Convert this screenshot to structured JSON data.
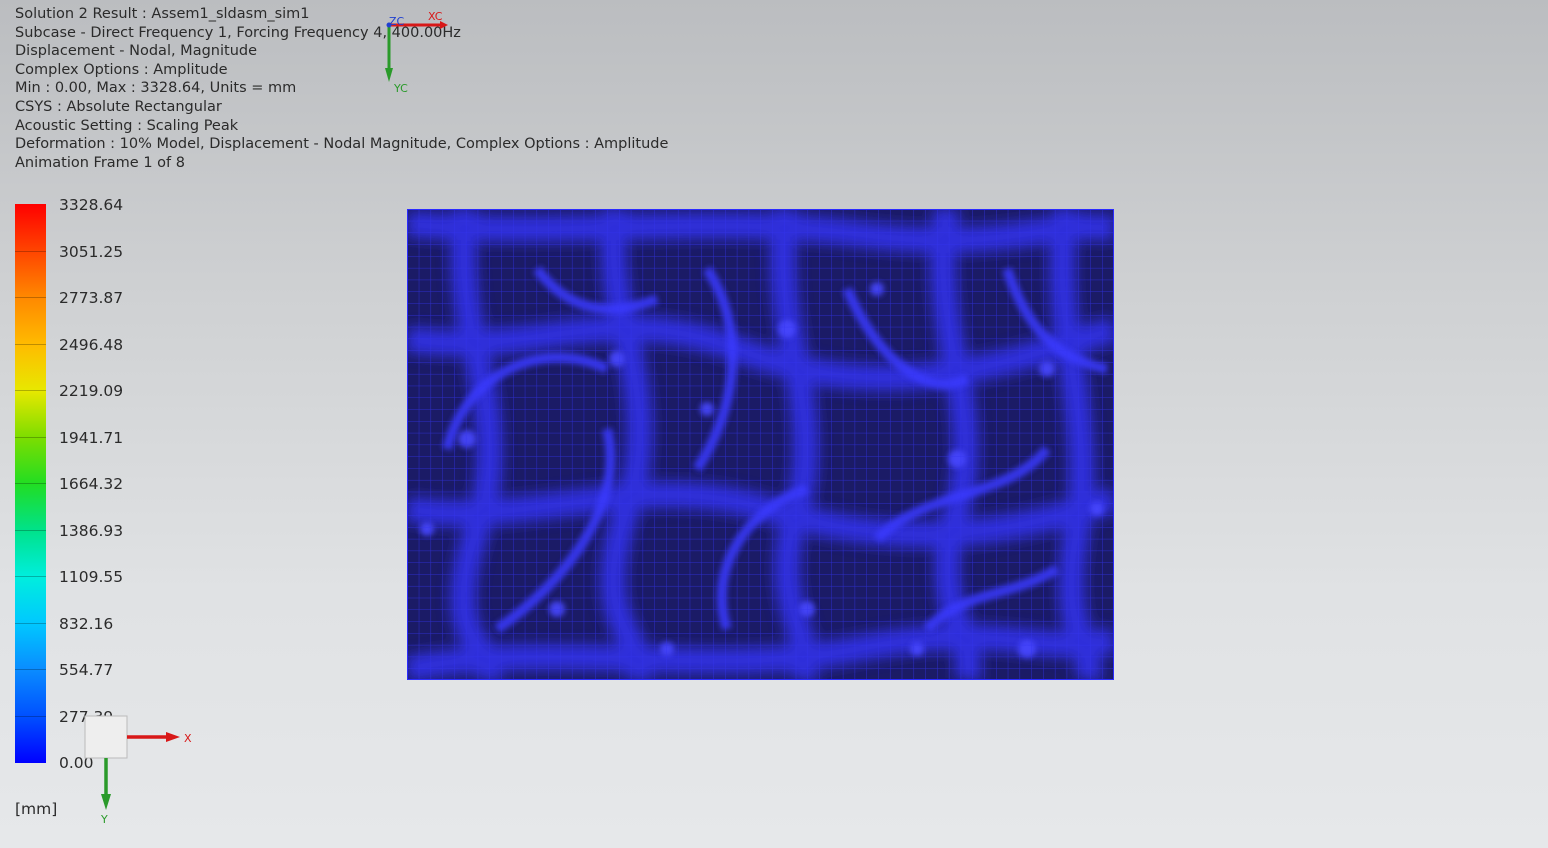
{
  "info": {
    "lines": [
      "Solution 2 Result : Assem1_sldasm_sim1",
      "Subcase - Direct Frequency 1, Forcing Frequency 4, 400.00Hz",
      "Displacement - Nodal, Magnitude",
      "Complex Options : Amplitude",
      "Min : 0.00, Max : 3328.64, Units = mm",
      "CSYS : Absolute Rectangular",
      "Acoustic Setting : Scaling Peak",
      "Deformation : 10% Model, Displacement - Nodal Magnitude, Complex Options : Amplitude",
      "Animation Frame 1 of 8"
    ]
  },
  "legend": {
    "values": [
      "3328.64",
      "3051.25",
      "2773.87",
      "2496.48",
      "2219.09",
      "1941.71",
      "1664.32",
      "1386.93",
      "1109.55",
      "832.16",
      "554.77",
      "277.39",
      "0.00"
    ],
    "units": "[mm]",
    "colors": [
      "#ff0000",
      "#ff4400",
      "#ff8800",
      "#ffba00",
      "#e8e800",
      "#7edd00",
      "#22dd22",
      "#00e28a",
      "#00eedd",
      "#00c8ff",
      "#0a8cff",
      "#0050ff",
      "#0000ff"
    ]
  },
  "view_triad": {
    "xc": "XC",
    "yc": "YC",
    "zc": "ZC",
    "x_color": "#d81818",
    "y_color": "#2a9a2a",
    "z_color": "#2040d0"
  },
  "csys_triad": {
    "x": "X",
    "y": "Y"
  },
  "model": {
    "icon": "fem-plate-mesh",
    "base_color": "#1b1b66",
    "peak_color": "#2a2aff",
    "mesh_color": "#3a3af0"
  }
}
